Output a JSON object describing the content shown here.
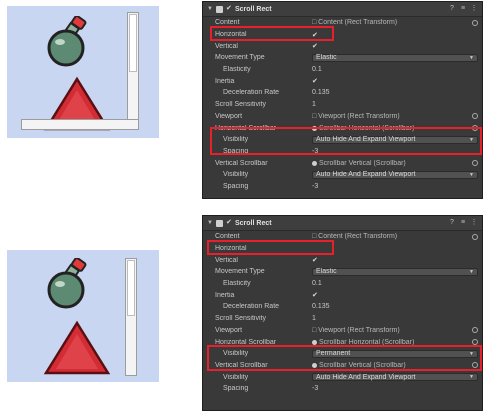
{
  "panels": [
    {
      "title": "Scroll Rect",
      "fields": {
        "content_label": "Content",
        "content_value": "□ Content (Rect Transform)",
        "horizontal_label": "Horizontal",
        "horizontal_value": "✔",
        "vertical_label": "Vertical",
        "vertical_value": "✔",
        "movement_label": "Movement Type",
        "movement_value": "Elastic",
        "elasticity_label": "Elasticity",
        "elasticity_value": "0.1",
        "inertia_label": "Inertia",
        "inertia_value": "✔",
        "decel_label": "Deceleration Rate",
        "decel_value": "0.135",
        "sensitivity_label": "Scroll Sensitivity",
        "sensitivity_value": "1",
        "viewport_label": "Viewport",
        "viewport_value": "□ Viewport (Rect Transform)",
        "hscroll_label": "Horizontal Scrollbar",
        "hscroll_value": "Scrollbar Horizontal (Scrollbar)",
        "hvis_label": "Visibility",
        "hvis_value": "Auto Hide And Expand Viewport",
        "hspacing_label": "Spacing",
        "hspacing_value": "-3",
        "vscroll_label": "Vertical Scrollbar",
        "vscroll_value": "Scrollbar Vertical (Scrollbar)",
        "vvis_label": "Visibility",
        "vvis_value": "Auto Hide And Expand Viewport",
        "vspacing_label": "Spacing",
        "vspacing_value": "-3"
      }
    },
    {
      "title": "Scroll Rect",
      "fields": {
        "content_label": "Content",
        "content_value": "□ Content (Rect Transform)",
        "horizontal_label": "Horizontal",
        "horizontal_value": "",
        "vertical_label": "Vertical",
        "vertical_value": "✔",
        "movement_label": "Movement Type",
        "movement_value": "Elastic",
        "elasticity_label": "Elasticity",
        "elasticity_value": "0.1",
        "inertia_label": "Inertia",
        "inertia_value": "✔",
        "decel_label": "Deceleration Rate",
        "decel_value": "0.135",
        "sensitivity_label": "Scroll Sensitivity",
        "sensitivity_value": "1",
        "viewport_label": "Viewport",
        "viewport_value": "□ Viewport (Rect Transform)",
        "hscroll_label": "Horizontal Scrollbar",
        "hscroll_value": "Scrollbar Horizontal (Scrollbar)",
        "hvis_label": "Visibility",
        "hvis_value": "Permanent",
        "hspacing_label": "Spacing",
        "hspacing_value": "",
        "vscroll_label": "Vertical Scrollbar",
        "vscroll_value": "Scrollbar Vertical (Scrollbar)",
        "vvis_label": "Visibility",
        "vvis_value": "Auto Hide And Expand Viewport",
        "vspacing_label": "Spacing",
        "vspacing_value": "-3"
      }
    }
  ],
  "colors": {
    "highlight": "#e8202b",
    "scene_bg": "#c9d6f1",
    "panel_bg": "#393939"
  },
  "icons": [
    "collapse-arrow-icon",
    "scroll-rect-component-icon",
    "help-icon",
    "preset-icon",
    "menu-kebab-icon",
    "object-target-icon",
    "dropdown-arrow-icon"
  ]
}
